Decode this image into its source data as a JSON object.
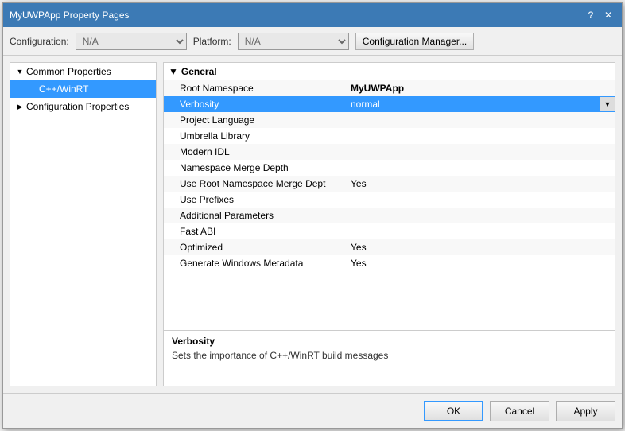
{
  "dialog": {
    "title": "MyUWPApp Property Pages",
    "help_btn": "?",
    "close_btn": "✕"
  },
  "config_bar": {
    "config_label": "Configuration:",
    "config_value": "N/A",
    "platform_label": "Platform:",
    "platform_value": "N/A",
    "manager_btn": "Configuration Manager..."
  },
  "sidebar": {
    "items": [
      {
        "label": "Common Properties",
        "type": "parent",
        "expanded": true,
        "indent": 0
      },
      {
        "label": "C++/WinRT",
        "type": "leaf",
        "selected": true,
        "indent": 1
      },
      {
        "label": "Configuration Properties",
        "type": "parent",
        "expanded": false,
        "indent": 0
      }
    ]
  },
  "properties": {
    "section": "General",
    "rows": [
      {
        "name": "Root Namespace",
        "value": "MyUWPApp",
        "bold": true,
        "highlighted": false
      },
      {
        "name": "Verbosity",
        "value": "normal",
        "bold": false,
        "highlighted": true,
        "has_dropdown": true
      },
      {
        "name": "Project Language",
        "value": "",
        "bold": false,
        "highlighted": false
      },
      {
        "name": "Umbrella Library",
        "value": "",
        "bold": false,
        "highlighted": false
      },
      {
        "name": "Modern IDL",
        "value": "",
        "bold": false,
        "highlighted": false
      },
      {
        "name": "Namespace Merge Depth",
        "value": "",
        "bold": false,
        "highlighted": false
      },
      {
        "name": "Use Root Namespace Merge Dept",
        "value": "Yes",
        "bold": false,
        "highlighted": false
      },
      {
        "name": "Use Prefixes",
        "value": "",
        "bold": false,
        "highlighted": false
      },
      {
        "name": "Additional Parameters",
        "value": "",
        "bold": false,
        "highlighted": false
      },
      {
        "name": "Fast ABI",
        "value": "",
        "bold": false,
        "highlighted": false
      },
      {
        "name": "Optimized",
        "value": "Yes",
        "bold": false,
        "highlighted": false
      },
      {
        "name": "Generate Windows Metadata",
        "value": "Yes",
        "bold": false,
        "highlighted": false
      }
    ]
  },
  "description": {
    "title": "Verbosity",
    "text": "Sets the importance of C++/WinRT build messages"
  },
  "buttons": {
    "ok": "OK",
    "cancel": "Cancel",
    "apply": "Apply"
  }
}
